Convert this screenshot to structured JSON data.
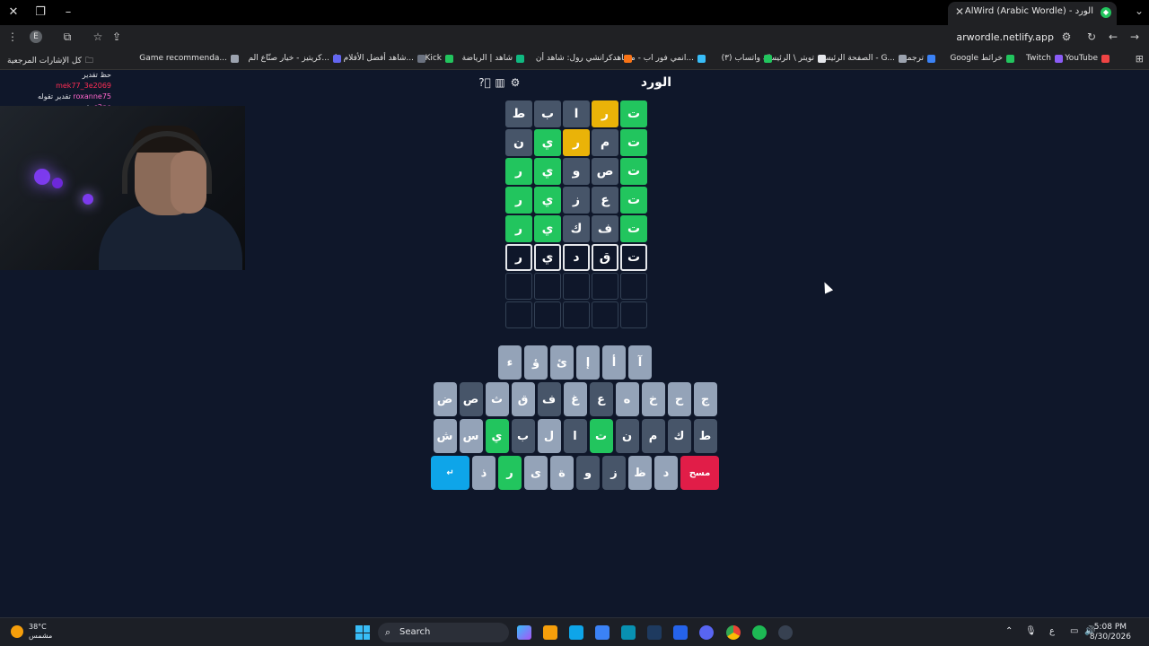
{
  "browser": {
    "tab_title": "AlWird (Arabic Wordle) - الورد",
    "url": "arwordle.netlify.app",
    "profile_initial": "E",
    "bookmarks": [
      {
        "label": "YouTube",
        "color": "#ef4444"
      },
      {
        "label": "Twitch",
        "color": "#8b5cf6"
      },
      {
        "label": "Google خرائط",
        "color": "#22c55e"
      },
      {
        "label": "ترجمة",
        "color": "#3b82f6"
      },
      {
        "label": "الصفحة الرئيسية - G...",
        "color": "#9ca3af"
      },
      {
        "label": "تويتر \\ الرئيسيّة",
        "color": "#e5e7eb"
      },
      {
        "label": "(٣) واتساب",
        "color": "#22c55e"
      },
      {
        "label": "انمي فور اب - مشاهد...",
        "color": "#38bdf8"
      },
      {
        "label": "كرانشي رول: شاهد أن...",
        "color": "#f97316"
      },
      {
        "label": "شاهد | الرياضة",
        "color": "#10b981"
      },
      {
        "label": "Kick",
        "color": "#22c55e"
      },
      {
        "label": "شاهد أفضل الأفلام وا...",
        "color": "#6b7280"
      },
      {
        "label": "كريتيز - خيار صنّاع الم...",
        "color": "#6366f1"
      },
      {
        "label": "Game recommenda...",
        "color": "#9ca3af"
      }
    ],
    "all_bookmarks": "كل الإشارات المرجعية"
  },
  "chat": [
    {
      "user": "mek77_3e2069",
      "text": "حظ تقدير",
      "user_class": "u1"
    },
    {
      "user": "roxanne75",
      "text": "تقدير تقوله",
      "user_class": "u2"
    },
    {
      "user": "s2pe",
      "text": "تقدير",
      "user_class": "u2"
    }
  ],
  "game": {
    "title": "الورد",
    "board": [
      [
        {
          "l": "ت",
          "s": "correct"
        },
        {
          "l": "ر",
          "s": "present"
        },
        {
          "l": "ا",
          "s": "absent"
        },
        {
          "l": "ب",
          "s": "absent"
        },
        {
          "l": "ط",
          "s": "absent"
        }
      ],
      [
        {
          "l": "ت",
          "s": "correct"
        },
        {
          "l": "م",
          "s": "absent"
        },
        {
          "l": "ر",
          "s": "present"
        },
        {
          "l": "ي",
          "s": "correct"
        },
        {
          "l": "ن",
          "s": "absent"
        }
      ],
      [
        {
          "l": "ت",
          "s": "correct"
        },
        {
          "l": "ص",
          "s": "absent"
        },
        {
          "l": "و",
          "s": "absent"
        },
        {
          "l": "ي",
          "s": "correct"
        },
        {
          "l": "ر",
          "s": "correct"
        }
      ],
      [
        {
          "l": "ت",
          "s": "correct"
        },
        {
          "l": "ع",
          "s": "absent"
        },
        {
          "l": "ز",
          "s": "absent"
        },
        {
          "l": "ي",
          "s": "correct"
        },
        {
          "l": "ر",
          "s": "correct"
        }
      ],
      [
        {
          "l": "ت",
          "s": "correct"
        },
        {
          "l": "ف",
          "s": "absent"
        },
        {
          "l": "ك",
          "s": "absent"
        },
        {
          "l": "ي",
          "s": "correct"
        },
        {
          "l": "ر",
          "s": "correct"
        }
      ],
      [
        {
          "l": "ت",
          "s": "typed"
        },
        {
          "l": "ق",
          "s": "typed"
        },
        {
          "l": "د",
          "s": "typed"
        },
        {
          "l": "ي",
          "s": "typed"
        },
        {
          "l": "ر",
          "s": "typed"
        }
      ],
      [
        {
          "l": "",
          "s": "empty"
        },
        {
          "l": "",
          "s": "empty"
        },
        {
          "l": "",
          "s": "empty"
        },
        {
          "l": "",
          "s": "empty"
        },
        {
          "l": "",
          "s": "empty"
        }
      ],
      [
        {
          "l": "",
          "s": "empty"
        },
        {
          "l": "",
          "s": "empty"
        },
        {
          "l": "",
          "s": "empty"
        },
        {
          "l": "",
          "s": "empty"
        },
        {
          "l": "",
          "s": "empty"
        }
      ]
    ],
    "keyboard": [
      [
        {
          "k": "آ",
          "s": "unused"
        },
        {
          "k": "أ",
          "s": "unused"
        },
        {
          "k": "إ",
          "s": "unused"
        },
        {
          "k": "ئ",
          "s": "unused"
        },
        {
          "k": "ؤ",
          "s": "unused"
        },
        {
          "k": "ء",
          "s": "unused"
        }
      ],
      [
        {
          "k": "ج",
          "s": "unused"
        },
        {
          "k": "ح",
          "s": "unused"
        },
        {
          "k": "خ",
          "s": "unused"
        },
        {
          "k": "ه",
          "s": "unused"
        },
        {
          "k": "ع",
          "s": "absent"
        },
        {
          "k": "غ",
          "s": "unused"
        },
        {
          "k": "ف",
          "s": "absent"
        },
        {
          "k": "ق",
          "s": "unused"
        },
        {
          "k": "ث",
          "s": "unused"
        },
        {
          "k": "ص",
          "s": "absent"
        },
        {
          "k": "ض",
          "s": "unused"
        }
      ],
      [
        {
          "k": "ط",
          "s": "absent"
        },
        {
          "k": "ك",
          "s": "absent"
        },
        {
          "k": "م",
          "s": "absent"
        },
        {
          "k": "ن",
          "s": "absent"
        },
        {
          "k": "ت",
          "s": "correct"
        },
        {
          "k": "ا",
          "s": "absent"
        },
        {
          "k": "ل",
          "s": "unused"
        },
        {
          "k": "ب",
          "s": "absent"
        },
        {
          "k": "ي",
          "s": "correct"
        },
        {
          "k": "س",
          "s": "unused"
        },
        {
          "k": "ش",
          "s": "unused"
        }
      ],
      [
        {
          "k": "مسح",
          "s": "del"
        },
        {
          "k": "د",
          "s": "unused"
        },
        {
          "k": "ظ",
          "s": "unused"
        },
        {
          "k": "ز",
          "s": "absent"
        },
        {
          "k": "و",
          "s": "absent"
        },
        {
          "k": "ة",
          "s": "unused"
        },
        {
          "k": "ى",
          "s": "unused"
        },
        {
          "k": "ر",
          "s": "correct"
        },
        {
          "k": "ذ",
          "s": "unused"
        },
        {
          "k": "↵",
          "s": "enter"
        }
      ]
    ]
  },
  "taskbar": {
    "temp": "38°C",
    "condition": "مشمس",
    "search": "Search",
    "time": "5:08 PM",
    "date": "8/30/2026",
    "lang": "ع"
  }
}
